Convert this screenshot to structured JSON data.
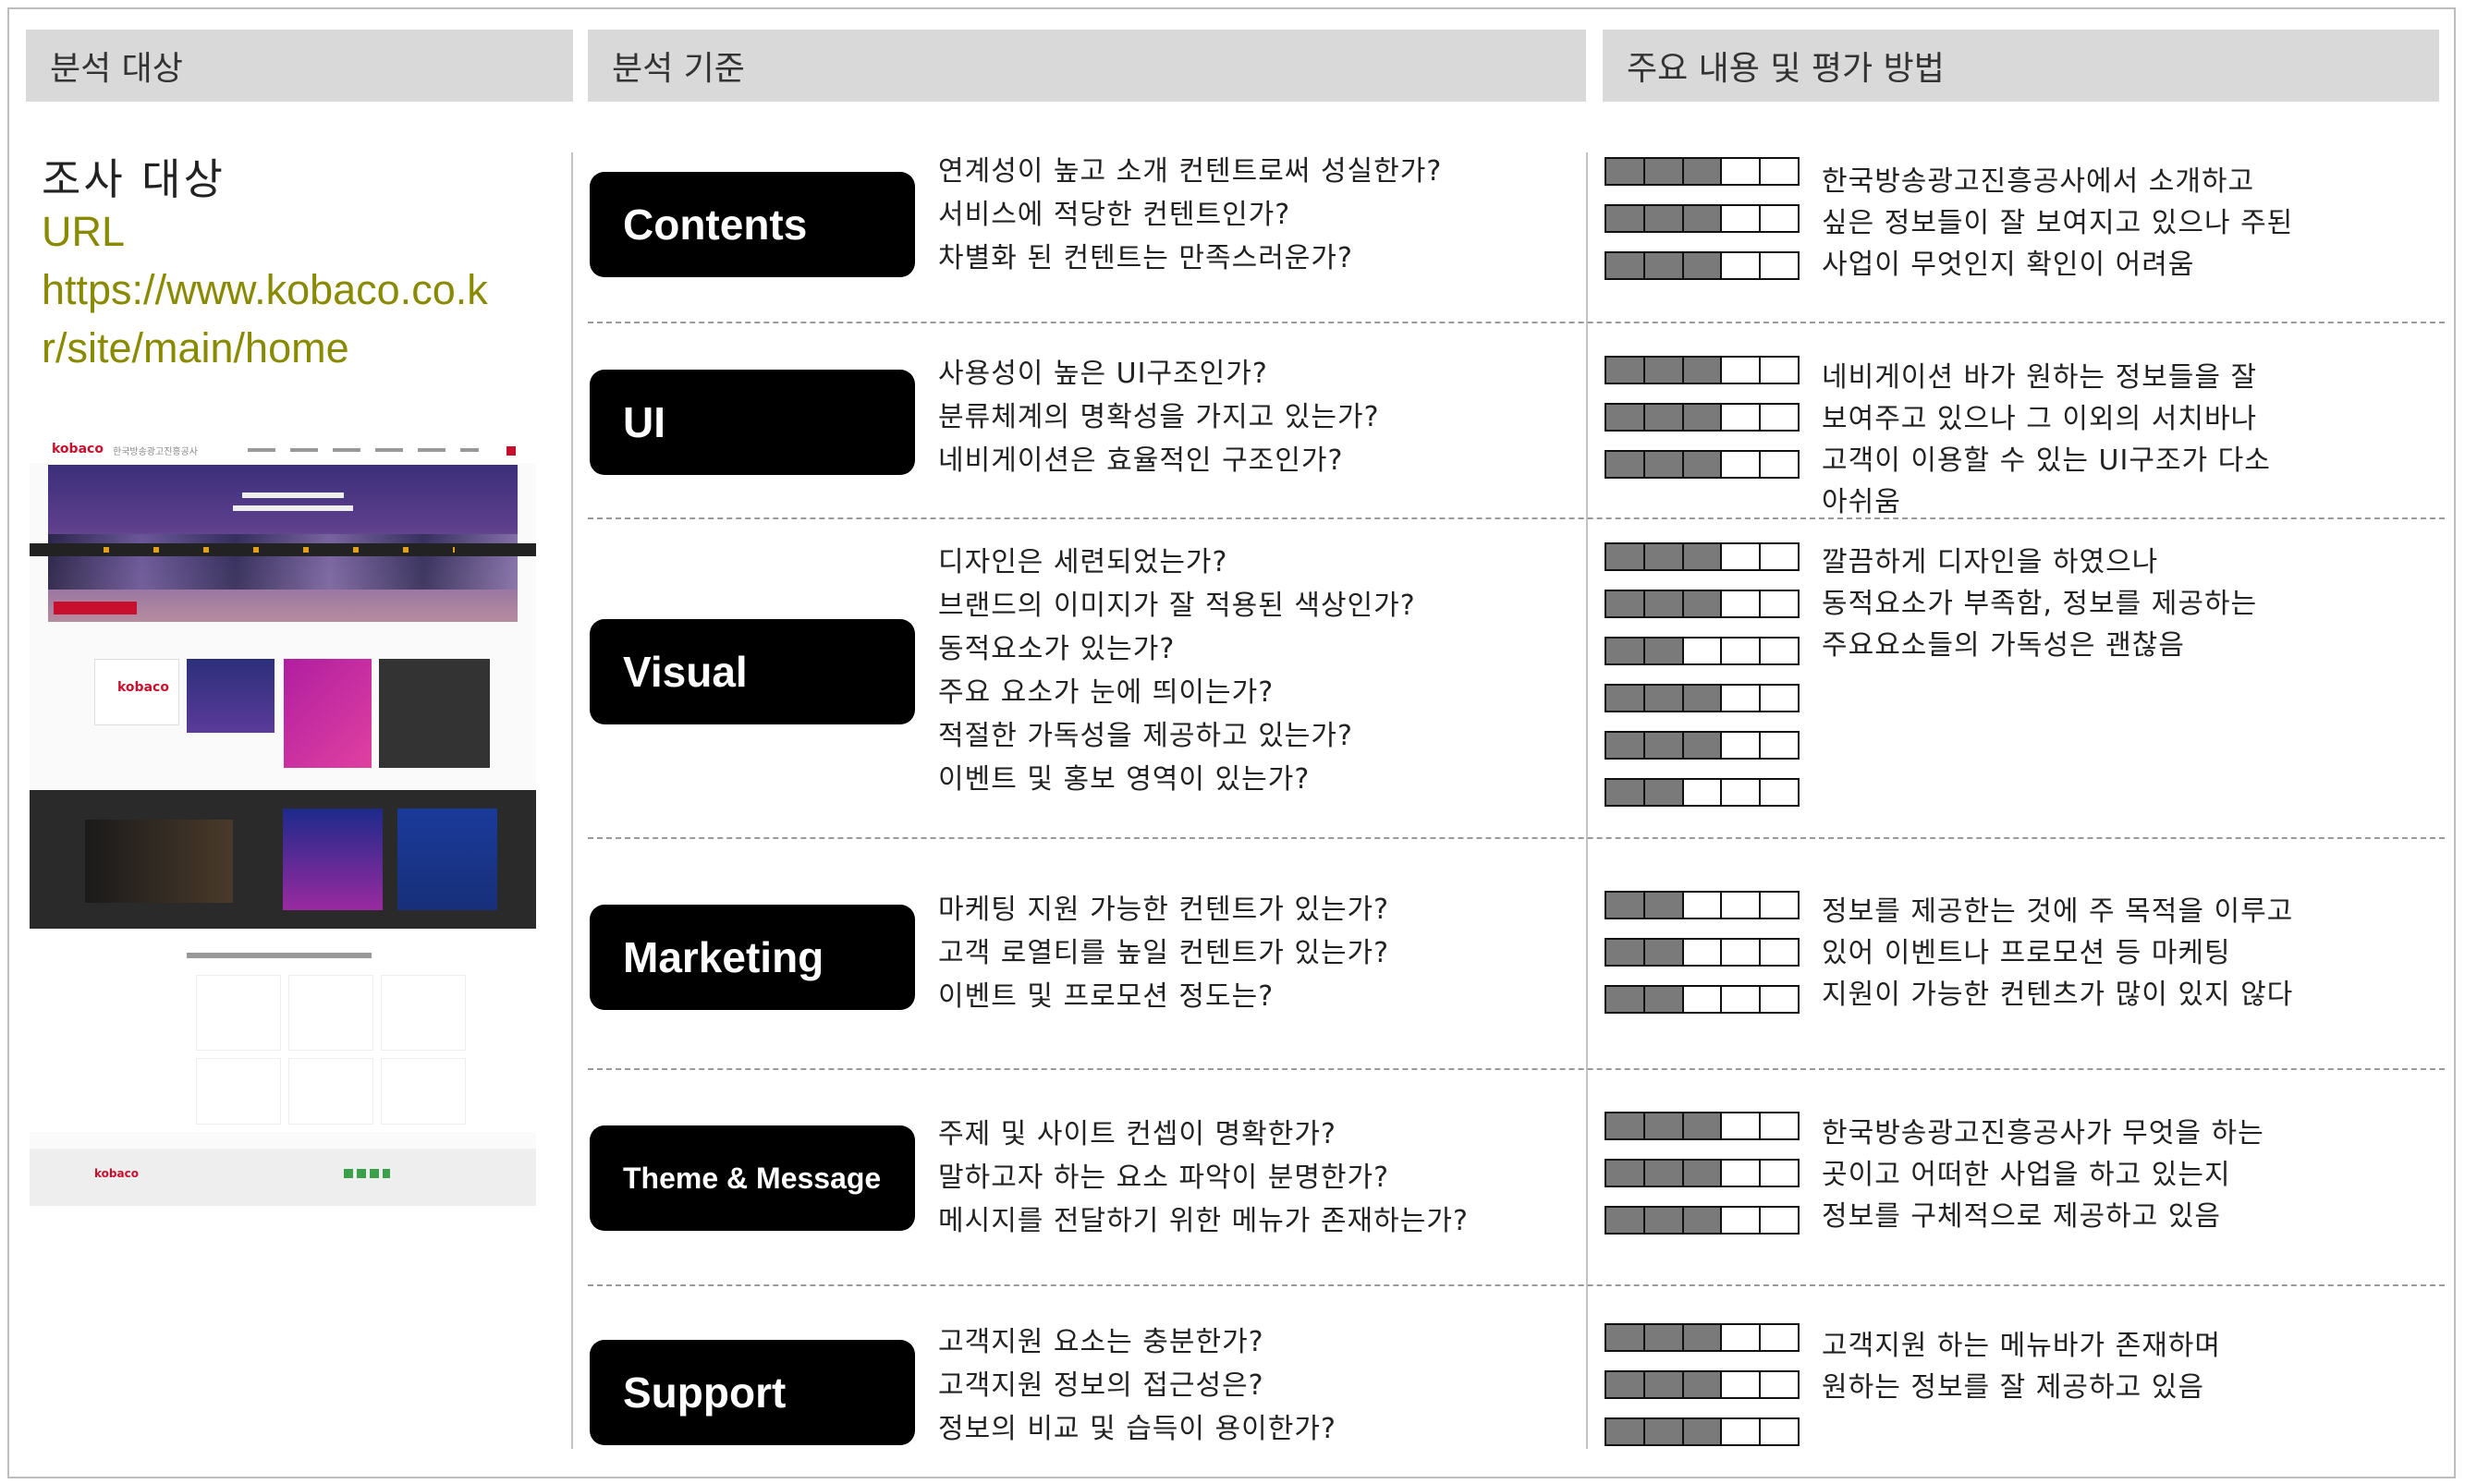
{
  "headers": {
    "target": "분석 대상",
    "criteria": "분석 기준",
    "content": "주요 내용 및 평가 방법"
  },
  "subject": {
    "title": "조사 대상",
    "url_label": "URL",
    "url_line1": "https://www.kobaco.co.k",
    "url_line2": "r/site/main/home"
  },
  "thumbnail": {
    "logo": "kobaco",
    "logo_sub": "한국방송광고진흥공사"
  },
  "rows": [
    {
      "category": "Contents",
      "questions": [
        "연계성이 높고 소개 컨텐트로써 성실한가?",
        "서비스에 적당한 컨텐트인가?",
        "차별화 된 컨텐트는 만족스러운가?"
      ],
      "ratings": [
        3,
        3,
        3
      ],
      "comment": [
        "한국방송광고진흥공사에서 소개하고",
        "싶은 정보들이 잘 보여지고 있으나 주된",
        "사업이 무엇인지 확인이 어려움"
      ]
    },
    {
      "category": "UI",
      "questions": [
        "사용성이 높은 UI구조인가?",
        "분류체계의 명확성을 가지고 있는가?",
        "네비게이션은 효율적인 구조인가?"
      ],
      "ratings": [
        3,
        3,
        3
      ],
      "comment": [
        "네비게이션 바가 원하는 정보들을 잘",
        "보여주고 있으나 그 이외의 서치바나",
        "고객이 이용할 수 있는 UI구조가 다소",
        "아쉬움"
      ]
    },
    {
      "category": "Visual",
      "questions": [
        "디자인은 세련되었는가?",
        "브랜드의 이미지가 잘 적용된 색상인가?",
        "동적요소가 있는가?",
        "주요 요소가 눈에 띄이는가?",
        "적절한 가독성을 제공하고 있는가?",
        "이벤트 및 홍보 영역이 있는가?"
      ],
      "ratings": [
        3,
        3,
        2,
        3,
        3,
        2
      ],
      "comment": [
        "깔끔하게 디자인을 하였으나",
        "동적요소가 부족함, 정보를 제공하는",
        "주요요소들의 가독성은 괜찮음"
      ]
    },
    {
      "category": "Marketing",
      "questions": [
        "마케팅 지원 가능한 컨텐트가 있는가?",
        "고객 로열티를 높일 컨텐트가 있는가?",
        "이벤트 및 프로모션 정도는?"
      ],
      "ratings": [
        2,
        2,
        2
      ],
      "comment": [
        "정보를 제공한는 것에 주 목적을 이루고",
        "있어 이벤트나 프로모션 등 마케팅",
        "지원이 가능한 컨텐츠가 많이 있지 않다"
      ]
    },
    {
      "category": "Theme & Message",
      "questions": [
        "주제 및 사이트 컨셉이 명확한가?",
        "말하고자 하는 요소 파악이 분명한가?",
        "메시지를 전달하기 위한 메뉴가 존재하는가?"
      ],
      "ratings": [
        3,
        3,
        3
      ],
      "comment": [
        "한국방송광고진흥공사가 무엇을 하는",
        "곳이고 어떠한 사업을 하고 있는지",
        "정보를 구체적으로 제공하고 있음"
      ]
    },
    {
      "category": "Support",
      "questions": [
        "고객지원 요소는 충분한가?",
        "고객지원 정보의 접근성은?",
        "정보의 비교 및 습득이 용이한가?"
      ],
      "ratings": [
        3,
        3,
        3
      ],
      "comment": [
        "고객지원 하는 메뉴바가 존재하며",
        "원하는 정보를 잘 제공하고 있음"
      ]
    }
  ],
  "scale_max": 5,
  "colors": {
    "header_bg": "#d9d9d9",
    "pill_bg": "#000000",
    "url": "#8a8a00",
    "bar_fill": "#7a7a7a"
  }
}
